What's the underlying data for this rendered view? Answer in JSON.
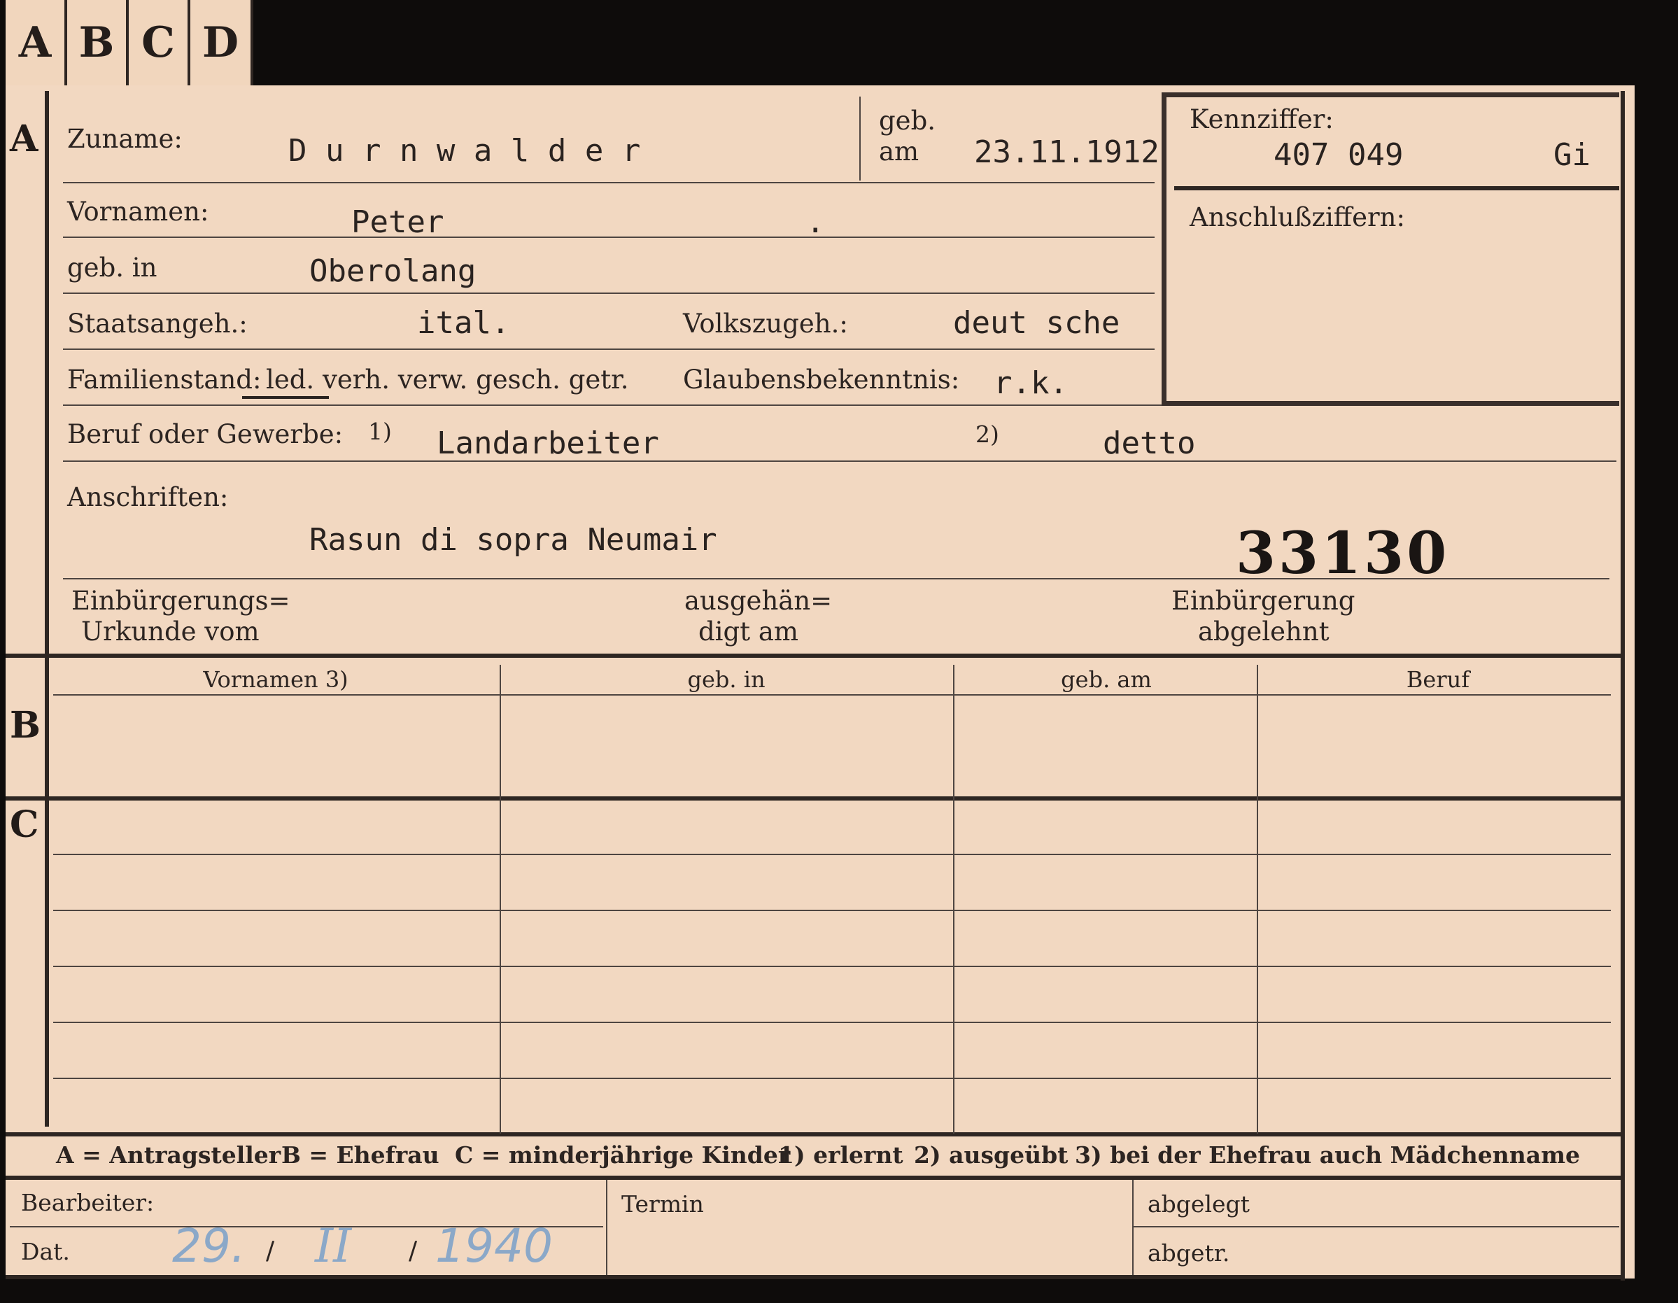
{
  "tabs": [
    "A",
    "B",
    "C",
    "D"
  ],
  "section_marks": {
    "a": "A",
    "b": "B",
    "c": "C"
  },
  "section_a": {
    "zuname_label": "Zuname:",
    "zuname_value": "D u r n w a l d e r",
    "geb_label_1": "geb.",
    "geb_label_2": "am",
    "geb_am_value": "23.11.1912",
    "kennziffer_label": "Kennziffer:",
    "kennziffer_value": "407 049",
    "kennziffer_suffix": "Gi",
    "anschluss_label": "Anschlußziffern:",
    "vornamen_label": "Vornamen:",
    "vornamen_value": "Peter",
    "vornamen_mark": ".",
    "geb_in_label": "geb. in",
    "geb_in_value": "Oberolang",
    "staatsangeh_label": "Staatsangeh.:",
    "staatsangeh_value": "ital.",
    "volkszugeh_label": "Volkszugeh.:",
    "volkszugeh_value": "deut sche",
    "familienstand_label": "Familienstand:",
    "familienstand_options": "led. verh. verw. gesch. getr.",
    "glaubens_label": "Glaubensbekenntnis:",
    "glaubens_value": "r.k.",
    "beruf_label": "Beruf oder Gewerbe:",
    "beruf_mark_1": "1)",
    "beruf_value_1": "Landarbeiter",
    "beruf_mark_2": "2)",
    "beruf_value_2": "detto",
    "anschriften_label": "Anschriften:",
    "anschriften_value": "Rasun di sopra  Neumair",
    "stamp_number": "33130",
    "einbuerg_label_1": "Einbürgerungs=",
    "einbuerg_label_2": "Urkunde vom",
    "ausgehaen_label_1": "ausgehän=",
    "ausgehaen_label_2": "digt am",
    "abgelehnt_label_1": "Einbürgerung",
    "abgelehnt_label_2": "abgelehnt"
  },
  "section_b": {
    "columns": [
      "Vornamen 3)",
      "geb. in",
      "geb. am",
      "Beruf"
    ]
  },
  "legend": {
    "a": "A = Antragsteller",
    "b": "B = Ehefrau",
    "c": "C = minderjährige Kinder",
    "n1": "1) erlernt",
    "n2": "2) ausgeübt",
    "n3": "3) bei der Ehefrau auch Mädchenname"
  },
  "footer": {
    "bearbeiter_label": "Bearbeiter:",
    "dat_label": "Dat.",
    "date_day": "29.",
    "date_sep_1": "/",
    "date_month": "II",
    "date_sep_2": "/",
    "date_year": "1940",
    "termin_label": "Termin",
    "abgelegt_label": "abgelegt",
    "abgetr_label": "abgetr."
  },
  "colors": {
    "paper": "#f2d8c1",
    "ink": "#2c2421",
    "rule": "#2e2622",
    "pencil": "#8ba8c8",
    "background": "#0e0c0b"
  }
}
